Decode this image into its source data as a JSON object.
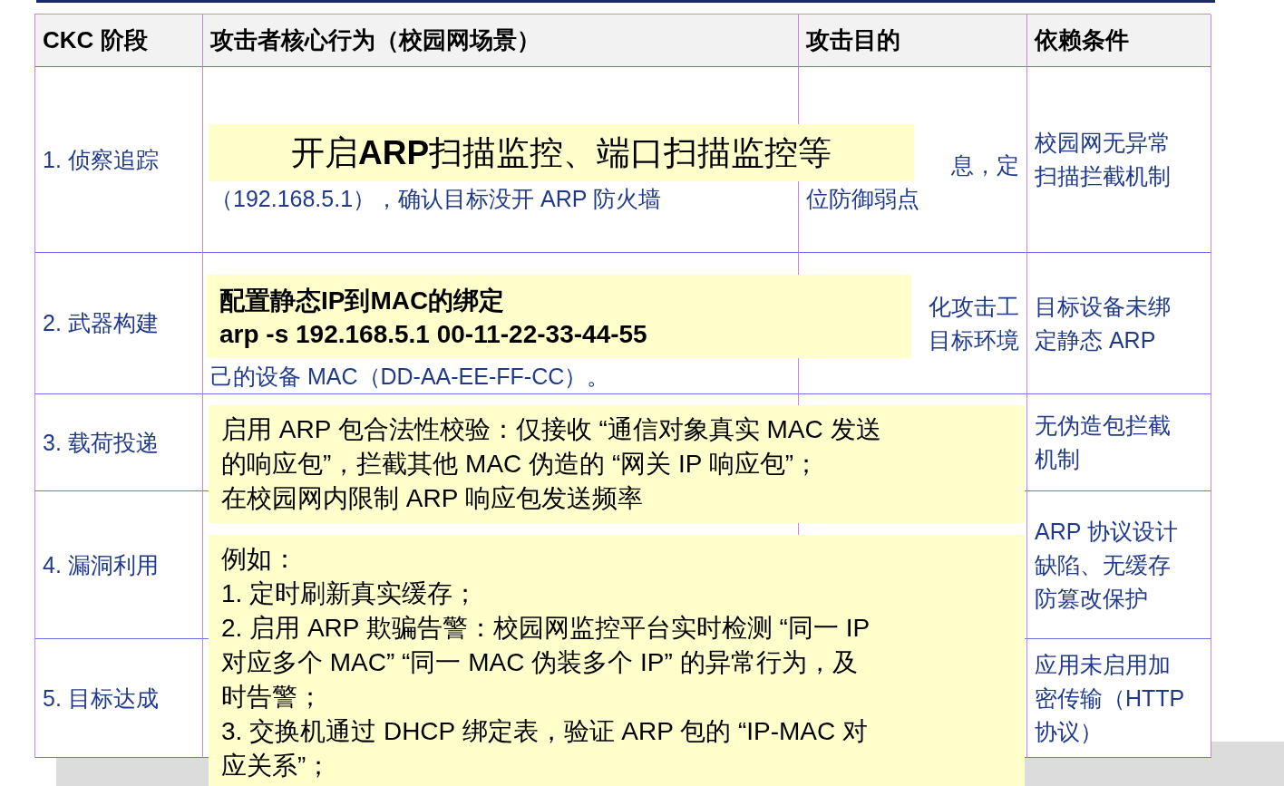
{
  "table": {
    "columns": [
      "CKC 阶段",
      "攻击者核心行为（校园网场景）",
      "攻击目的",
      "依赖条件"
    ],
    "rows": [
      {
        "stage": "1. 侦察追踪",
        "behavior": [
          {
            "text": "（192.168.5.1），确认目标没开 ARP 防火墙",
            "clipped": false
          }
        ],
        "purpose": [
          {
            "text": "息，定",
            "clipped": true
          },
          {
            "text": "位防御弱点",
            "clipped": false
          }
        ],
        "condition": "校园网无异常扫描拦截机制"
      },
      {
        "stage": "2. 武器构建",
        "behavior": [
          {
            "text": "己的设备 MAC（DD-AA-EE-FF-CC）。",
            "clipped": false
          }
        ],
        "purpose": [
          {
            "text": "化攻击工",
            "clipped": true
          },
          {
            "text": "目标环境",
            "clipped": true
          }
        ],
        "condition": "目标设备未绑定静态 ARP"
      },
      {
        "stage": "3. 载荷投递",
        "behavior": [],
        "purpose": [],
        "condition": "无伪造包拦截机制"
      },
      {
        "stage": "4. 漏洞利用",
        "behavior": [],
        "purpose": [],
        "condition": "ARP 协议设计缺陷、无缓存防篡改保护"
      },
      {
        "stage": "5. 目标达成",
        "behavior": [],
        "purpose": [],
        "condition": "应用未启用加密传输（HTTP 协议）"
      }
    ]
  },
  "notes": [
    {
      "kind": "title",
      "lines": [
        "开启**ARP**扫描监控、端口扫描监控等"
      ]
    },
    {
      "kind": "bold",
      "lines": [
        "配置静态IP到MAC的绑定",
        "arp -s 192.168.5.1 00-11-22-33-44-55"
      ]
    },
    {
      "kind": "plain",
      "lines": [
        "启用 ARP 包合法性校验：仅接收 “通信对象真实 MAC 发送",
        "的响应包”，拦截其他 MAC 伪造的 “网关 IP 响应包”；",
        "在校园网内限制 ARP 响应包发送频率"
      ]
    },
    {
      "kind": "plain",
      "lines": [
        "例如：",
        "1. 定时刷新真实缓存；",
        "2. 启用 ARP 欺骗告警：校园网监控平台实时检测 “同一 IP",
        "对应多个 MAC” “同一 MAC 伪装多个 IP” 的异常行为，及",
        "时告警；",
        "3. 交换机通过 DHCP 绑定表，验证 ARP 包的 “IP-MAC 对",
        "应关系”；"
      ]
    }
  ]
}
